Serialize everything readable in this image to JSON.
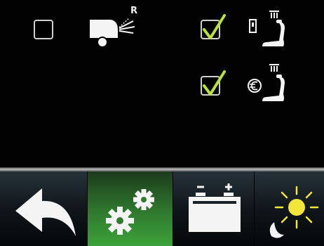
{
  "options": [
    {
      "id": "rear-wash",
      "checked": false,
      "icon": "rear-wiper-icon",
      "icon_label": "R"
    },
    {
      "id": "seat-heat-key",
      "checked": true,
      "icon": "seat-heating-key-icon"
    },
    {
      "id": "seat-heat-eco",
      "checked": true,
      "icon": "seat-heating-eco-icon"
    }
  ],
  "toolbar": {
    "buttons": [
      {
        "id": "back",
        "icon": "back-arrow-icon",
        "active": false
      },
      {
        "id": "settings",
        "icon": "gears-icon",
        "active": true
      },
      {
        "id": "battery",
        "icon": "battery-icon",
        "active": false
      },
      {
        "id": "day-night",
        "icon": "sun-moon-icon",
        "active": false
      }
    ]
  },
  "colors": {
    "check": "#b8e23a",
    "icon": "#f4f4f4",
    "active_bg": "#3da23a",
    "sun": "#f2e63a"
  }
}
